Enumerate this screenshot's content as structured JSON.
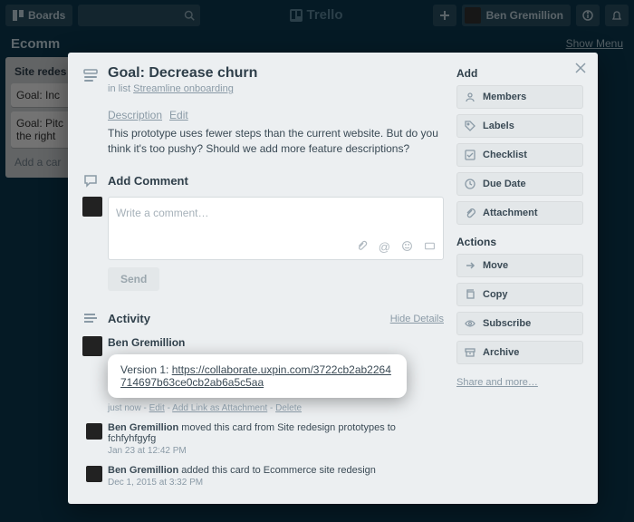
{
  "topbar": {
    "boards_label": "Boards",
    "brand": "Trello",
    "user_name": "Ben Gremillion"
  },
  "board": {
    "title_truncated": "Ecomm",
    "show_menu": "Show Menu",
    "list": {
      "header": "Site redes",
      "card1": "Goal: Inc",
      "card2": "Goal: Pitc\nthe right",
      "add": "Add a car"
    }
  },
  "card": {
    "title": "Goal: Decrease churn",
    "in_list_prefix": "in list ",
    "in_list_name": "Streamline onboarding",
    "description_label": "Description",
    "edit_label": "Edit",
    "description_text": "This prototype uses fewer steps than the current website. But do you think it's too pushy? Should we add more feature descriptions?",
    "add_comment_header": "Add Comment",
    "comment_placeholder": "Write a comment…",
    "send_label": "Send",
    "activity_header": "Activity",
    "hide_details": "Hide Details",
    "activity": {
      "author": "Ben Gremillion",
      "highlight_prefix": "Version 1: ",
      "highlight_link": "https://collaborate.uxpin.com/3722cb2ab2264714697b63ce0cb2ab6a5c5aa",
      "highlight_meta_time": "just now",
      "highlight_meta_edit": "Edit",
      "highlight_meta_addlink": "Add Link as Attachment",
      "highlight_meta_delete": "Delete",
      "item2_text": " moved this card from Site redesign prototypes to fchfyhfgyfg",
      "item2_time": "Jan 23 at 12:42 PM",
      "item3_text": " added this card to Ecommerce site redesign",
      "item3_time": "Dec 1, 2015 at 3:32 PM"
    }
  },
  "sidebar": {
    "add_header": "Add",
    "members": "Members",
    "labels": "Labels",
    "checklist": "Checklist",
    "due_date": "Due Date",
    "attachment": "Attachment",
    "actions_header": "Actions",
    "move": "Move",
    "copy": "Copy",
    "subscribe": "Subscribe",
    "archive": "Archive",
    "share_more": "Share and more…"
  }
}
